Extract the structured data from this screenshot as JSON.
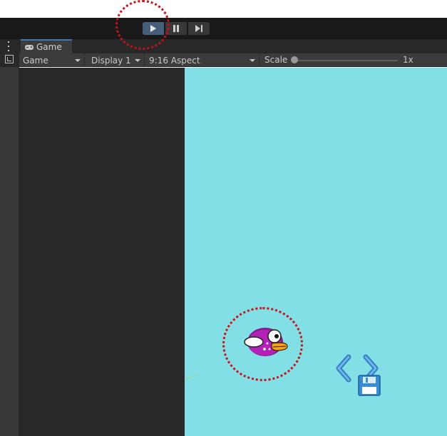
{
  "toolbar": {
    "play_icon": "play-icon",
    "pause_icon": "pause-icon",
    "step_icon": "step-icon",
    "play_active_color": "#46607c"
  },
  "tabs": [
    {
      "label": "Game",
      "icon": "gamepad-icon",
      "active": true
    }
  ],
  "game_toolbar": {
    "view_dropdown": "Game",
    "display_dropdown": "Display 1",
    "aspect_dropdown": "9:16 Aspect",
    "scale_label": "Scale",
    "scale_value": "1x",
    "scale_slider_level": 0
  },
  "game_view": {
    "background_color": "#82dfe6",
    "sprites": [
      "bird-sprite",
      "code-save-icon"
    ]
  },
  "annotations": {
    "highlight_color": "#c4141a",
    "highlighted": [
      "play-button",
      "bird-sprite"
    ]
  }
}
